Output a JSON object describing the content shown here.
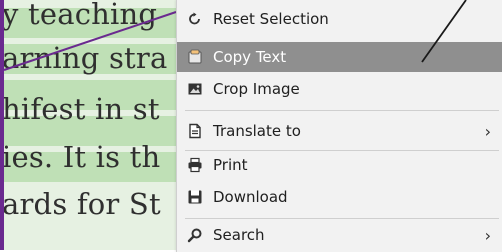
{
  "document": {
    "lines": [
      "y teaching",
      "arning stra",
      "hifest in st",
      "ies. It is th",
      "ards for St"
    ]
  },
  "context_menu": {
    "items": [
      {
        "label": "Reset Selection",
        "icon": "reset-selection-icon"
      },
      {
        "label": "Copy Text",
        "icon": "copy-text-icon"
      },
      {
        "label": "Crop Image",
        "icon": "crop-image-icon"
      },
      {
        "label": "Translate to",
        "icon": "translate-icon",
        "submenu": true
      },
      {
        "label": "Print",
        "icon": "print-icon"
      },
      {
        "label": "Download",
        "icon": "download-icon"
      },
      {
        "label": "Search",
        "icon": "search-icon",
        "submenu": true
      }
    ],
    "highlighted_item": "Copy Text",
    "submenu_arrow": "›"
  },
  "colors": {
    "page_background": "#e6f1e2",
    "text_highlight": "#bfe0b6",
    "selection_line": "#6a2a8f",
    "menu_background": "#f2f2f2",
    "menu_hover": "#8f8f8f"
  }
}
